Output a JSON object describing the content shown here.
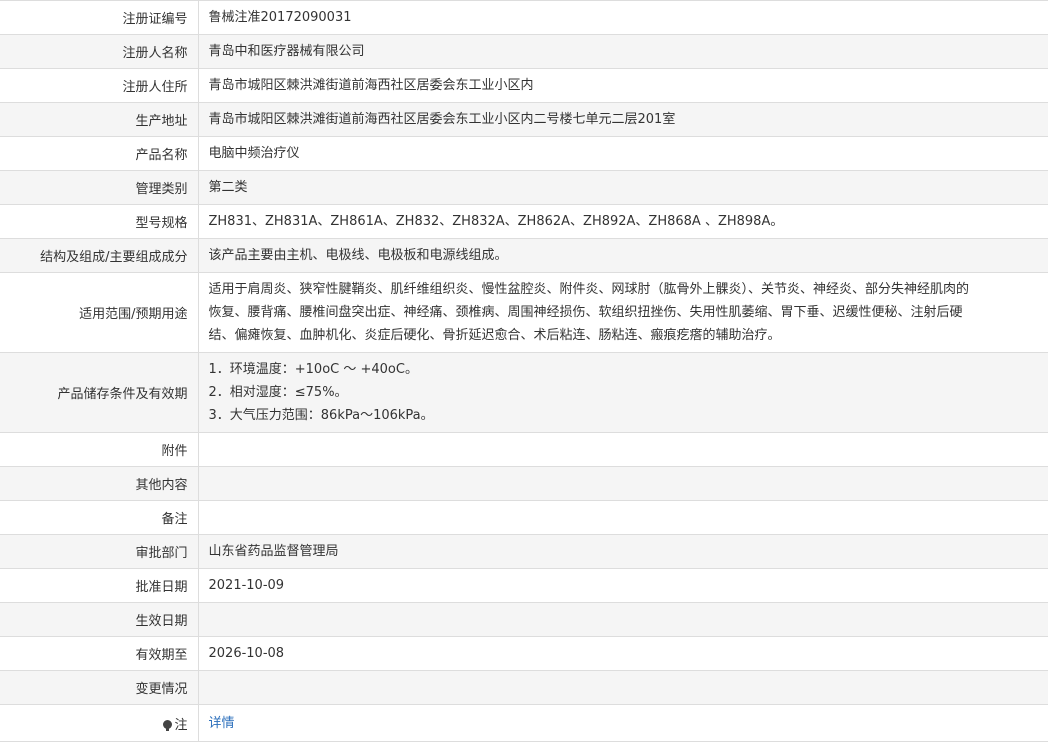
{
  "rows": [
    {
      "label": "注册证编号",
      "value": "鲁械注准20172090031"
    },
    {
      "label": "注册人名称",
      "value": "青岛中和医疗器械有限公司"
    },
    {
      "label": "注册人住所",
      "value": "青岛市城阳区棘洪滩街道前海西社区居委会东工业小区内"
    },
    {
      "label": "生产地址",
      "value": "青岛市城阳区棘洪滩街道前海西社区居委会东工业小区内二号楼七单元二层201室"
    },
    {
      "label": "产品名称",
      "value": "电脑中频治疗仪"
    },
    {
      "label": "管理类别",
      "value": "第二类"
    },
    {
      "label": "型号规格",
      "value": "ZH831、ZH831A、ZH861A、ZH832、ZH832A、ZH862A、ZH892A、ZH868A 、ZH898A。"
    },
    {
      "label": "结构及组成/主要组成成分",
      "value": "该产品主要由主机、电极线、电极板和电源线组成。"
    },
    {
      "label": "适用范围/预期用途",
      "lines": [
        "适用于肩周炎、狭窄性腱鞘炎、肌纤维组织炎、慢性盆腔炎、附件炎、网球肘（肱骨外上髁炎）、关节炎、神经炎、部分失神经肌肉的",
        "恢复、腰背痛、腰椎间盘突出症、神经痛、颈椎病、周围神经损伤、软组织扭挫伤、失用性肌萎缩、胃下垂、迟缓性便秘、注射后硬",
        "结、偏瘫恢复、血肿机化、炎症后硬化、骨折延迟愈合、术后粘连、肠粘连、瘢痕疙瘩的辅助治疗。"
      ]
    },
    {
      "label": "产品储存条件及有效期",
      "lines": [
        "1．环境温度：+10oC ～ +40oC。",
        "2．相对湿度：≤75%。",
        "3．大气压力范围：86kPa～106kPa。"
      ]
    },
    {
      "label": "附件",
      "value": ""
    },
    {
      "label": "其他内容",
      "value": ""
    },
    {
      "label": "备注",
      "value": ""
    },
    {
      "label": "审批部门",
      "value": "山东省药品监督管理局"
    },
    {
      "label": "批准日期",
      "value": "2021-10-09"
    },
    {
      "label": "生效日期",
      "value": ""
    },
    {
      "label": "有效期至",
      "value": "2026-10-08"
    },
    {
      "label": "变更情况",
      "value": ""
    }
  ],
  "note": {
    "label": "注",
    "icon": "lightbulb-icon",
    "link": "详情"
  }
}
